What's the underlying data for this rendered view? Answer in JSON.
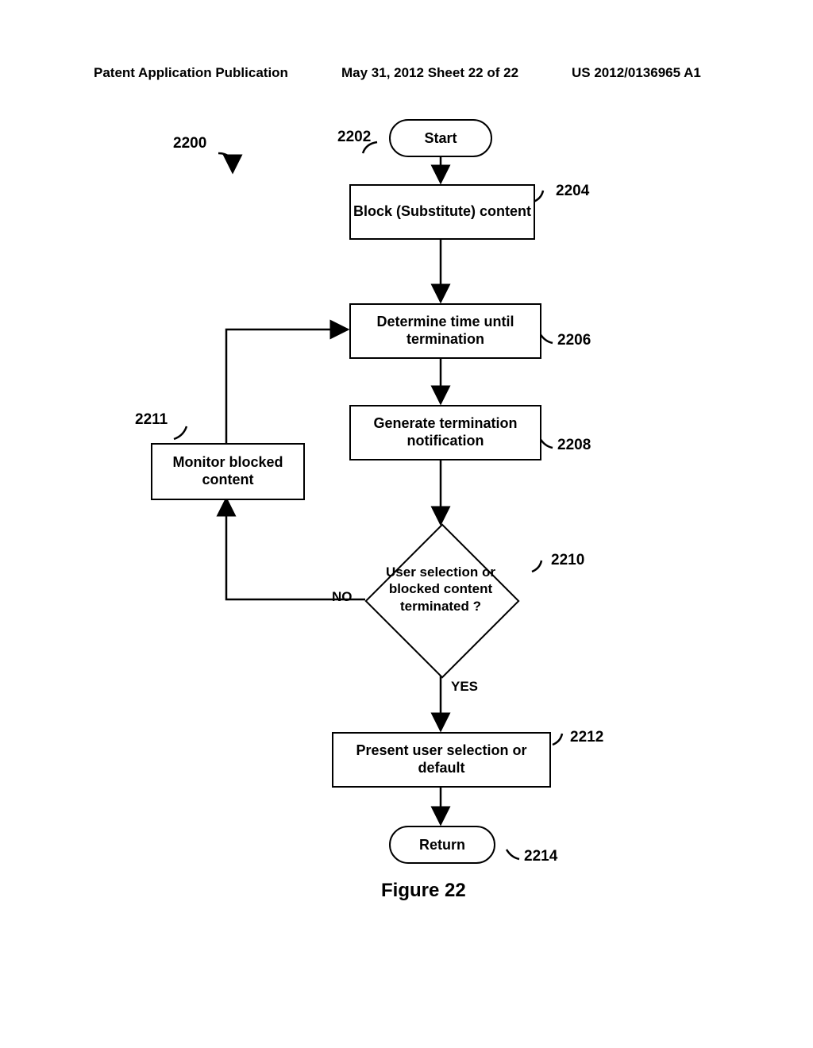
{
  "header": {
    "left": "Patent Application Publication",
    "center": "May 31, 2012   Sheet 22 of 22",
    "right": "US 2012/0136965 A1"
  },
  "refs": {
    "r2200": "2200",
    "r2202": "2202",
    "r2204": "2204",
    "r2206": "2206",
    "r2208": "2208",
    "r2210": "2210",
    "r2211": "2211",
    "r2212": "2212",
    "r2214": "2214"
  },
  "nodes": {
    "start": "Start",
    "block": "Block (Substitute) content",
    "determine": "Determine time until termination",
    "generate": "Generate termination notification",
    "monitor": "Monitor blocked content",
    "decision": "User selection or blocked content terminated ?",
    "present": "Present user selection or default",
    "return": "Return"
  },
  "labels": {
    "no": "NO",
    "yes": "YES"
  },
  "figure": "Figure 22"
}
